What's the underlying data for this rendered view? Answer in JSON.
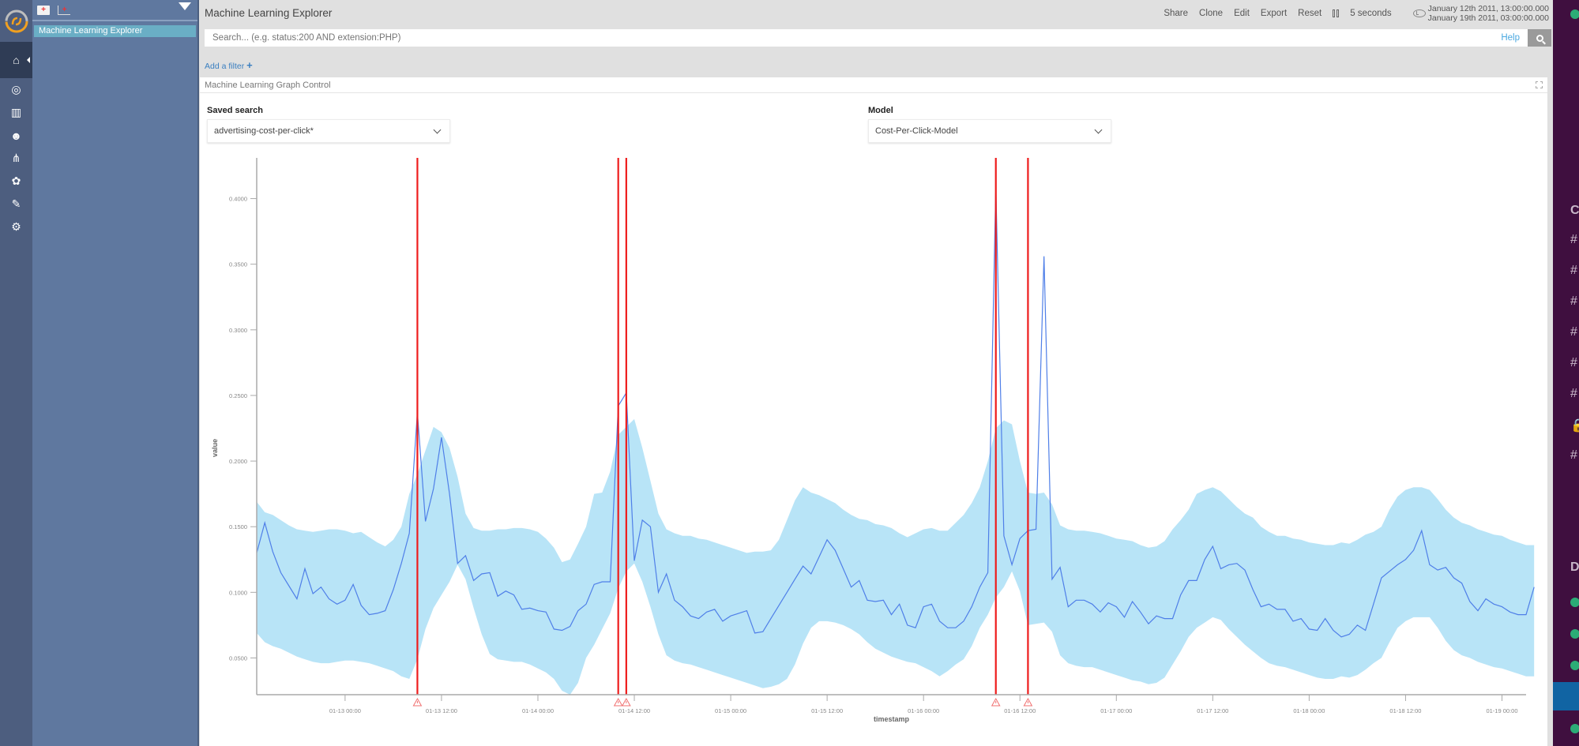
{
  "app": {
    "title": "Machine Learning Explorer"
  },
  "rail": {
    "items": [
      {
        "name": "home",
        "icon": "home-icon",
        "glyph": "⌂",
        "active": true
      },
      {
        "name": "discover",
        "icon": "compass-icon",
        "glyph": "◎"
      },
      {
        "name": "visualize",
        "icon": "bar-chart-icon",
        "glyph": "▥"
      },
      {
        "name": "dashboard",
        "icon": "bear-face-icon",
        "glyph": "☻"
      },
      {
        "name": "graph",
        "icon": "graph-network-icon",
        "glyph": "⋔"
      },
      {
        "name": "machine-learning",
        "icon": "brain-icon",
        "glyph": "✿"
      },
      {
        "name": "dev-tools",
        "icon": "wrench-icon",
        "glyph": "✎"
      },
      {
        "name": "settings",
        "icon": "gear-icon",
        "glyph": "⚙"
      }
    ]
  },
  "sidebar": {
    "tools": {
      "new_folder": "+",
      "new_dashboard": "+"
    },
    "items": [
      {
        "label": "Machine Learning Explorer",
        "selected": true
      }
    ]
  },
  "topbar": {
    "title": "Machine Learning Explorer",
    "menu": [
      "Share",
      "Clone",
      "Edit",
      "Export",
      "Reset"
    ],
    "refresh_interval": "5 seconds",
    "time_from": "January 12th 2011, 13:00:00.000",
    "time_to": "January 19th 2011, 03:00:00.000"
  },
  "search": {
    "placeholder": "Search... (e.g. status:200 AND extension:PHP)",
    "value": "",
    "help_label": "Help"
  },
  "filters": {
    "add_label": "Add a filter",
    "add_glyph": "+"
  },
  "panel": {
    "title": "Machine Learning Graph Control",
    "saved_search_label": "Saved search",
    "saved_search_value": "advertising-cost-per-click*",
    "model_label": "Model",
    "model_value": "Cost-Per-Click-Model"
  },
  "colors": {
    "line": "#4f7fe8",
    "band": "#b8e4f7",
    "anomaly": "#ee1c1c",
    "axis": "#9a9a9a"
  },
  "chart_data": {
    "type": "line",
    "title": "",
    "xlabel": "timestamp",
    "ylabel": "value",
    "x_start": "2011-01-12 13:00",
    "x_step_hours": 1,
    "x_range_hours": [
      0,
      158
    ],
    "ylim": [
      0.022,
      0.428
    ],
    "grid": false,
    "legend": "none",
    "y_ticks": [
      {
        "value": 0.05,
        "label": "0.0500"
      },
      {
        "value": 0.1,
        "label": "0.1000"
      },
      {
        "value": 0.15,
        "label": "0.1500"
      },
      {
        "value": 0.2,
        "label": "0.2000"
      },
      {
        "value": 0.25,
        "label": "0.2500"
      },
      {
        "value": 0.3,
        "label": "0.3000"
      },
      {
        "value": 0.35,
        "label": "0.3500"
      },
      {
        "value": 0.4,
        "label": "0.4000"
      }
    ],
    "x_ticks": [
      {
        "hour": 11,
        "label": "01-13 00:00"
      },
      {
        "hour": 23,
        "label": "01-13 12:00"
      },
      {
        "hour": 35,
        "label": "01-14 00:00"
      },
      {
        "hour": 47,
        "label": "01-14 12:00"
      },
      {
        "hour": 59,
        "label": "01-15 00:00"
      },
      {
        "hour": 71,
        "label": "01-15 12:00"
      },
      {
        "hour": 83,
        "label": "01-16 00:00"
      },
      {
        "hour": 95,
        "label": "01-16 12:00"
      },
      {
        "hour": 107,
        "label": "01-17 00:00"
      },
      {
        "hour": 119,
        "label": "01-17 12:00"
      },
      {
        "hour": 131,
        "label": "01-18 00:00"
      },
      {
        "hour": 143,
        "label": "01-18 12:00"
      },
      {
        "hour": 155,
        "label": "01-19 00:00"
      }
    ],
    "series": [
      {
        "name": "actual",
        "values": [
          0.13,
          0.153,
          0.131,
          0.115,
          0.105,
          0.095,
          0.118,
          0.099,
          0.104,
          0.095,
          0.091,
          0.094,
          0.106,
          0.09,
          0.083,
          0.084,
          0.086,
          0.102,
          0.122,
          0.145,
          0.237,
          0.154,
          0.179,
          0.218,
          0.175,
          0.122,
          0.128,
          0.109,
          0.114,
          0.115,
          0.097,
          0.101,
          0.098,
          0.087,
          0.088,
          0.086,
          0.085,
          0.072,
          0.071,
          0.074,
          0.086,
          0.091,
          0.106,
          0.108,
          0.108,
          0.242,
          0.252,
          0.124,
          0.155,
          0.15,
          0.1,
          0.114,
          0.094,
          0.089,
          0.082,
          0.08,
          0.085,
          0.087,
          0.078,
          0.082,
          0.084,
          0.086,
          0.069,
          0.07,
          0.08,
          0.09,
          0.1,
          0.11,
          0.12,
          0.114,
          0.127,
          0.14,
          0.132,
          0.118,
          0.104,
          0.109,
          0.094,
          0.093,
          0.094,
          0.083,
          0.091,
          0.075,
          0.073,
          0.089,
          0.091,
          0.078,
          0.073,
          0.073,
          0.078,
          0.089,
          0.104,
          0.115,
          0.409,
          0.143,
          0.121,
          0.141,
          0.147,
          0.148,
          0.356,
          0.11,
          0.119,
          0.089,
          0.094,
          0.094,
          0.091,
          0.085,
          0.092,
          0.089,
          0.081,
          0.093,
          0.085,
          0.076,
          0.082,
          0.08,
          0.08,
          0.098,
          0.109,
          0.109,
          0.125,
          0.135,
          0.118,
          0.121,
          0.122,
          0.117,
          0.102,
          0.089,
          0.091,
          0.087,
          0.087,
          0.078,
          0.08,
          0.072,
          0.071,
          0.08,
          0.071,
          0.066,
          0.068,
          0.075,
          0.071,
          0.091,
          0.111,
          0.116,
          0.121,
          0.125,
          0.132,
          0.147,
          0.121,
          0.117,
          0.119,
          0.111,
          0.107,
          0.093,
          0.086,
          0.095,
          0.091,
          0.089,
          0.085,
          0.083,
          0.083,
          0.104
        ]
      },
      {
        "name": "upper_bound",
        "values": [
          0.169,
          0.161,
          0.159,
          0.155,
          0.151,
          0.148,
          0.147,
          0.146,
          0.147,
          0.148,
          0.148,
          0.147,
          0.145,
          0.146,
          0.142,
          0.138,
          0.135,
          0.14,
          0.15,
          0.175,
          0.19,
          0.208,
          0.226,
          0.222,
          0.21,
          0.188,
          0.16,
          0.149,
          0.147,
          0.147,
          0.148,
          0.148,
          0.149,
          0.149,
          0.148,
          0.146,
          0.141,
          0.134,
          0.123,
          0.125,
          0.137,
          0.15,
          0.175,
          0.176,
          0.192,
          0.22,
          0.226,
          0.232,
          0.21,
          0.185,
          0.16,
          0.148,
          0.145,
          0.143,
          0.143,
          0.141,
          0.14,
          0.138,
          0.136,
          0.134,
          0.132,
          0.13,
          0.131,
          0.131,
          0.132,
          0.14,
          0.155,
          0.17,
          0.18,
          0.176,
          0.174,
          0.171,
          0.168,
          0.163,
          0.159,
          0.156,
          0.155,
          0.152,
          0.151,
          0.149,
          0.145,
          0.142,
          0.145,
          0.148,
          0.149,
          0.147,
          0.147,
          0.153,
          0.159,
          0.168,
          0.18,
          0.2,
          0.225,
          0.231,
          0.228,
          0.2,
          0.176,
          0.175,
          0.176,
          0.167,
          0.151,
          0.148,
          0.147,
          0.147,
          0.146,
          0.145,
          0.143,
          0.141,
          0.14,
          0.139,
          0.136,
          0.134,
          0.135,
          0.139,
          0.148,
          0.155,
          0.163,
          0.175,
          0.178,
          0.18,
          0.177,
          0.171,
          0.165,
          0.16,
          0.157,
          0.15,
          0.146,
          0.143,
          0.143,
          0.141,
          0.14,
          0.138,
          0.137,
          0.136,
          0.136,
          0.138,
          0.137,
          0.14,
          0.144,
          0.146,
          0.15,
          0.163,
          0.173,
          0.178,
          0.18,
          0.18,
          0.178,
          0.171,
          0.163,
          0.157,
          0.153,
          0.151,
          0.148,
          0.146,
          0.144,
          0.143,
          0.14,
          0.138,
          0.136,
          0.136
        ]
      },
      {
        "name": "lower_bound",
        "values": [
          0.069,
          0.062,
          0.059,
          0.057,
          0.054,
          0.051,
          0.049,
          0.047,
          0.046,
          0.046,
          0.047,
          0.048,
          0.048,
          0.047,
          0.046,
          0.044,
          0.042,
          0.04,
          0.036,
          0.034,
          0.049,
          0.072,
          0.088,
          0.098,
          0.108,
          0.121,
          0.11,
          0.088,
          0.068,
          0.053,
          0.049,
          0.048,
          0.047,
          0.047,
          0.045,
          0.042,
          0.039,
          0.034,
          0.025,
          0.018,
          0.031,
          0.05,
          0.06,
          0.072,
          0.084,
          0.103,
          0.116,
          0.122,
          0.108,
          0.089,
          0.068,
          0.052,
          0.048,
          0.046,
          0.045,
          0.043,
          0.041,
          0.039,
          0.037,
          0.035,
          0.033,
          0.031,
          0.029,
          0.027,
          0.028,
          0.03,
          0.034,
          0.045,
          0.061,
          0.073,
          0.078,
          0.078,
          0.077,
          0.075,
          0.072,
          0.068,
          0.062,
          0.057,
          0.054,
          0.051,
          0.049,
          0.047,
          0.046,
          0.043,
          0.04,
          0.036,
          0.04,
          0.045,
          0.049,
          0.059,
          0.073,
          0.083,
          0.096,
          0.104,
          0.116,
          0.101,
          0.075,
          0.076,
          0.077,
          0.07,
          0.052,
          0.046,
          0.044,
          0.043,
          0.043,
          0.041,
          0.039,
          0.037,
          0.035,
          0.033,
          0.032,
          0.03,
          0.031,
          0.035,
          0.045,
          0.055,
          0.066,
          0.073,
          0.077,
          0.081,
          0.079,
          0.072,
          0.066,
          0.06,
          0.055,
          0.05,
          0.046,
          0.044,
          0.043,
          0.041,
          0.039,
          0.037,
          0.035,
          0.034,
          0.034,
          0.036,
          0.035,
          0.037,
          0.041,
          0.046,
          0.05,
          0.062,
          0.073,
          0.078,
          0.081,
          0.081,
          0.081,
          0.073,
          0.063,
          0.056,
          0.052,
          0.05,
          0.047,
          0.045,
          0.043,
          0.042,
          0.04,
          0.038,
          0.036,
          0.036
        ]
      }
    ],
    "anomalies": [
      {
        "hour": 20,
        "value": 0.237
      },
      {
        "hour": 45,
        "value": 0.242
      },
      {
        "hour": 46,
        "value": 0.252
      },
      {
        "hour": 92,
        "value": 0.409
      },
      {
        "hour": 96,
        "value": 0.356
      }
    ]
  },
  "right_app": {
    "channel_glyphs": [
      "#",
      "#",
      "#",
      "#",
      "#",
      "#",
      "🔒",
      "#"
    ],
    "section_initials": [
      "C",
      "D"
    ]
  }
}
